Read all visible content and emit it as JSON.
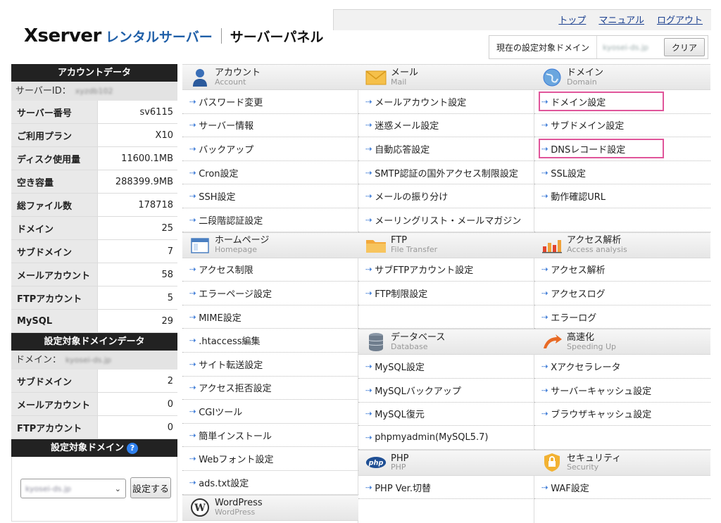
{
  "header": {
    "logo_brand": "Xserver",
    "logo_rental": "レンタルサーバー",
    "logo_panel": "サーバーパネル",
    "top_links": [
      "トップ",
      "マニュアル",
      "ログアウト"
    ],
    "domain_label": "現在の設定対象ドメイン",
    "domain_value": "kyosei-ds.jp",
    "clear_button": "クリア"
  },
  "sidebar": {
    "account_title": "アカウントデータ",
    "server_id_label": "サーバーID：",
    "server_id_value": "xyzdb102",
    "account_rows": [
      {
        "k": "サーバー番号",
        "v": "sv6115"
      },
      {
        "k": "ご利用プラン",
        "v": "X10"
      },
      {
        "k": "ディスク使用量",
        "v": "11600.1MB"
      },
      {
        "k": "空き容量",
        "v": "288399.9MB"
      },
      {
        "k": "総ファイル数",
        "v": "178718"
      },
      {
        "k": "ドメイン",
        "v": "25"
      },
      {
        "k": "サブドメイン",
        "v": "7"
      },
      {
        "k": "メールアカウント",
        "v": "58"
      },
      {
        "k": "FTPアカウント",
        "v": "5"
      },
      {
        "k": "MySQL",
        "v": "29"
      }
    ],
    "domain_data_title": "設定対象ドメインデータ",
    "domain_label": "ドメイン：",
    "domain_value": "kyosei-ds.jp",
    "domain_rows": [
      {
        "k": "サブドメイン",
        "v": "2"
      },
      {
        "k": "メールアカウント",
        "v": "0"
      },
      {
        "k": "FTPアカウント",
        "v": "0"
      }
    ],
    "target_domain_title": "設定対象ドメイン",
    "help": "?",
    "select_value": "kyosei-ds.jp",
    "set_button": "設定する"
  },
  "col1": {
    "sections": [
      {
        "ja": "アカウント",
        "en": "Account",
        "icon": "account-icon",
        "items": [
          "パスワード変更",
          "サーバー情報",
          "バックアップ",
          "Cron設定",
          "SSH設定",
          "二段階認証設定"
        ]
      },
      {
        "ja": "ホームページ",
        "en": "Homepage",
        "icon": "homepage-icon",
        "items": [
          "アクセス制限",
          "エラーページ設定",
          "MIME設定",
          ".htaccess編集",
          "サイト転送設定",
          "アクセス拒否設定",
          "CGIツール",
          "簡単インストール",
          "Webフォント設定",
          "ads.txt設定"
        ]
      },
      {
        "ja": "WordPress",
        "en": "WordPress",
        "icon": "wordpress-icon",
        "items": []
      }
    ]
  },
  "col2": {
    "sections": [
      {
        "ja": "メール",
        "en": "Mail",
        "icon": "mail-icon",
        "items": [
          "メールアカウント設定",
          "迷惑メール設定",
          "自動応答設定",
          "SMTP認証の国外アクセス制限設定",
          "メールの振り分け",
          "メーリングリスト・メールマガジン"
        ]
      },
      {
        "ja": "FTP",
        "en": "File Transfer",
        "icon": "ftp-folder-icon",
        "items": [
          "サブFTPアカウント設定",
          "FTP制限設定",
          ""
        ]
      },
      {
        "ja": "データベース",
        "en": "Database",
        "icon": "database-icon",
        "items": [
          "MySQL設定",
          "MySQLバックアップ",
          "MySQL復元",
          "phpmyadmin(MySQL5.7)"
        ]
      },
      {
        "ja": "PHP",
        "en": "PHP",
        "icon": "php-icon",
        "items": [
          "PHP Ver.切替"
        ]
      }
    ]
  },
  "col3": {
    "sections": [
      {
        "ja": "ドメイン",
        "en": "Domain",
        "icon": "domain-globe-icon",
        "items": [
          "ドメイン設定",
          "サブドメイン設定",
          "DNSレコード設定",
          "SSL設定",
          "動作確認URL",
          ""
        ]
      },
      {
        "ja": "アクセス解析",
        "en": "Access analysis",
        "icon": "access-analysis-icon",
        "items": [
          "アクセス解析",
          "アクセスログ",
          "エラーログ"
        ]
      },
      {
        "ja": "高速化",
        "en": "Speeding Up",
        "icon": "speeding-up-icon",
        "items": [
          "Xアクセラレータ",
          "サーバーキャッシュ設定",
          "ブラウザキャッシュ設定",
          ""
        ]
      },
      {
        "ja": "セキュリティ",
        "en": "Security",
        "icon": "security-icon",
        "items": [
          "WAF設定"
        ]
      }
    ]
  },
  "highlight_color": "#e0559a",
  "arrow_glyph": "⇢"
}
